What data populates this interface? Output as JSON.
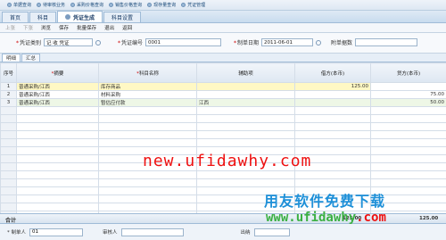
{
  "top_links": [
    "单据查询",
    "待审核业务",
    "采购价格查询",
    "销售价格查询",
    "现存量查询",
    "凭证管理"
  ],
  "tabs": [
    "首页",
    "科目",
    "凭证生成",
    "科目设置"
  ],
  "toolbar": {
    "up": "上张",
    "down": "下张",
    "browse": "浏览",
    "save": "保存",
    "batch_save": "批量保存",
    "exit": "退出",
    "back": "返回"
  },
  "form": {
    "voucher_type_label": "凭证类别",
    "voucher_type_value": "记 收 凭证",
    "voucher_no_label": "凭证编号",
    "voucher_no_value": "0001",
    "date_label": "制单日期",
    "date_value": "2011-06-01",
    "attachments_label": "附单据数",
    "attachments_value": ""
  },
  "subtabs": [
    "明细",
    "汇总"
  ],
  "grid": {
    "headers": [
      "序号",
      "摘要",
      "科目名称",
      "辅助项",
      "借方(本币)",
      "贷方(本币)"
    ],
    "rows": [
      {
        "no": "1",
        "summary": "普通采购/江西",
        "account": "库存商品",
        "aux": "",
        "debit": "125.00",
        "credit": ""
      },
      {
        "no": "2",
        "summary": "普通采购/江西",
        "account": "材料采购",
        "aux": "",
        "debit": "",
        "credit": "75.00"
      },
      {
        "no": "3",
        "summary": "普通采购/江西",
        "account": "暂估应付款",
        "aux": "江西",
        "debit": "",
        "credit": "50.00"
      }
    ],
    "empty_rows": 16
  },
  "totals": {
    "label": "合计",
    "debit": "125.00",
    "credit": "125.00"
  },
  "footer": {
    "maker_label": "制单人",
    "maker_value": "01",
    "reviewer_label": "审核人",
    "reviewer_value": "",
    "poster_label": "出纳",
    "poster_value": ""
  },
  "watermark": {
    "main": "new.ufidawhy.com",
    "cn": "用友软件免费下载",
    "url_prefix": "www.",
    "url_mid": "ufidawhy",
    "url_suffix": ".com"
  }
}
